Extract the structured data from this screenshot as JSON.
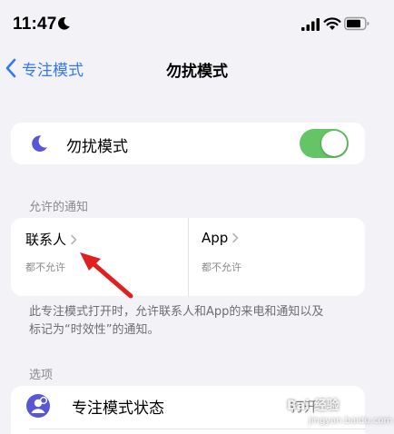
{
  "status_bar": {
    "time": "11:47"
  },
  "nav": {
    "back_label": "专注模式",
    "title": "勿扰模式"
  },
  "dnd": {
    "label": "勿扰模式",
    "toggle_on": true,
    "toggle_color": "#65c466"
  },
  "allowed_notifications": {
    "header": "允许的通知",
    "people": {
      "title": "联系人",
      "subtitle": "都不允许"
    },
    "apps": {
      "title": "App",
      "subtitle": "都不允许"
    },
    "footer_line1": "此专注模式打开时，允许联系人和App的来电和通知以及",
    "footer_line2": "标记为“时效性”的通知。"
  },
  "options": {
    "header": "选项",
    "focus_status": {
      "label": "专注模式状态",
      "value": "打开"
    }
  },
  "watermark": {
    "text": "Bai 经验",
    "url": "jingyan.baidu.com"
  },
  "colors": {
    "accent": "#3478f6",
    "moon": "#5856d6",
    "arrow": "#e02020",
    "background": "#f2f2f7"
  }
}
